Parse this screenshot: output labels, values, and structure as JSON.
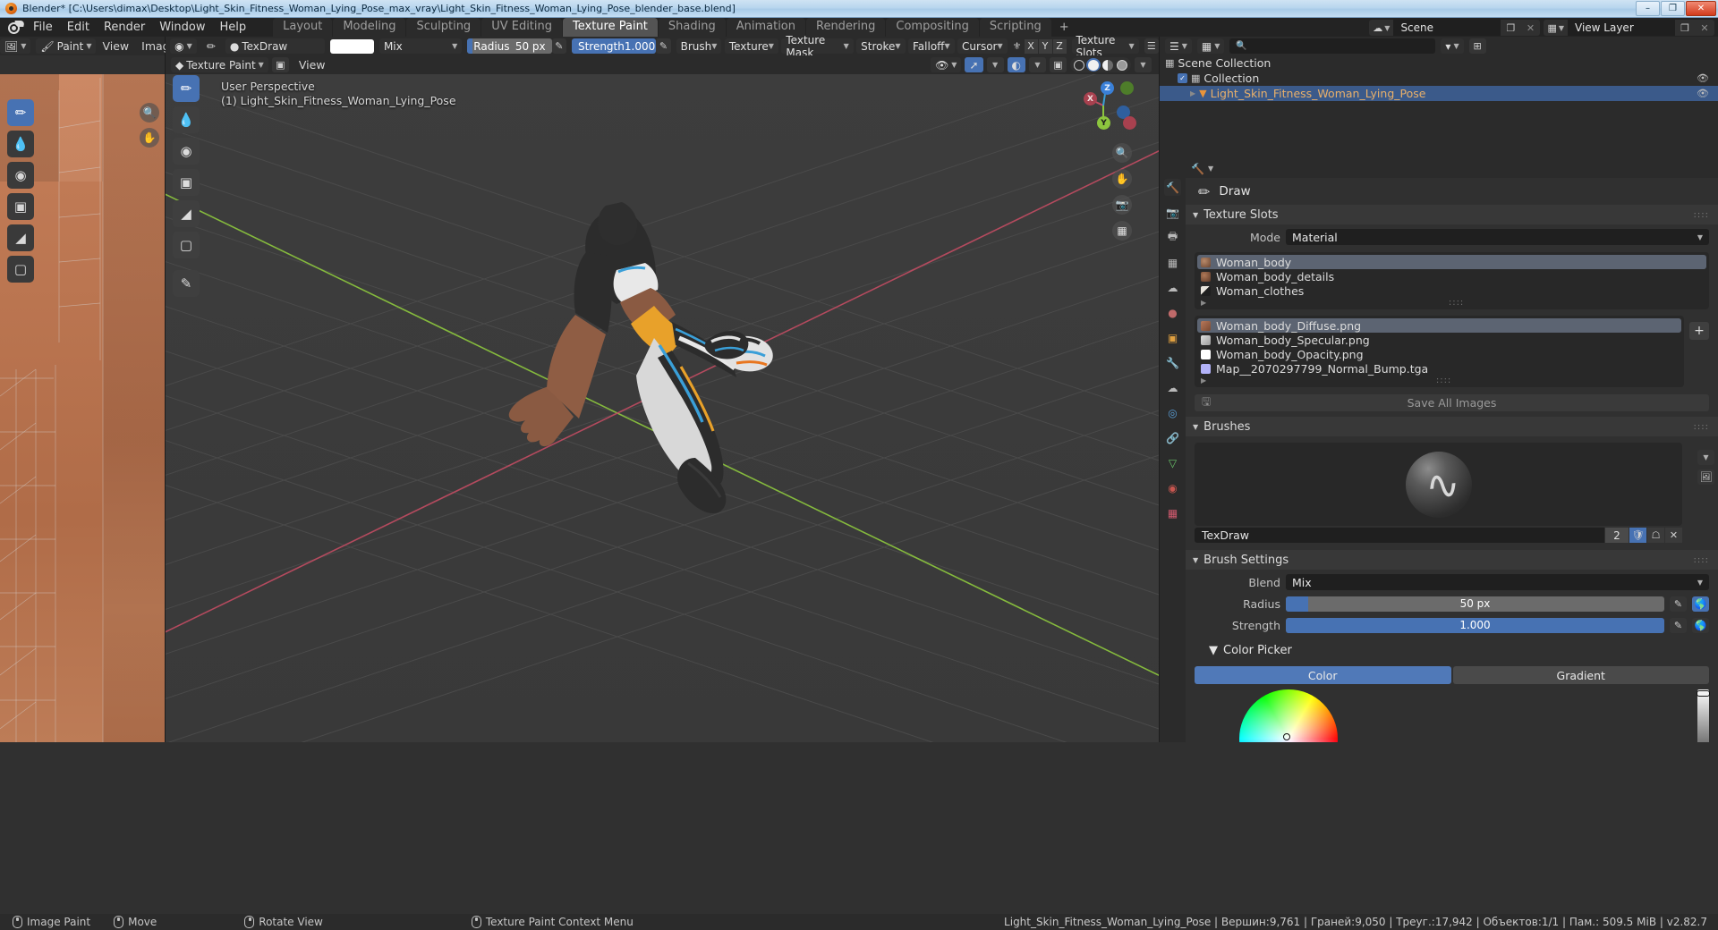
{
  "window": {
    "title": "Blender* [C:\\Users\\dimax\\Desktop\\Light_Skin_Fitness_Woman_Lying_Pose_max_vray\\Light_Skin_Fitness_Woman_Lying_Pose_blender_base.blend]",
    "minimize": "–",
    "maximize": "❐",
    "close": "✕"
  },
  "menu": {
    "items": [
      "File",
      "Edit",
      "Render",
      "Window",
      "Help"
    ]
  },
  "workspaces": {
    "tabs": [
      "Layout",
      "Modeling",
      "Sculpting",
      "UV Editing",
      "Texture Paint",
      "Shading",
      "Animation",
      "Rendering",
      "Compositing",
      "Scripting"
    ],
    "active": "Texture Paint",
    "add": "+"
  },
  "topbar_right": {
    "scene_label": "Scene",
    "scene_icon": "scene-icon",
    "viewlayer_label": "View Layer",
    "viewlayer_icon": "viewlayer-icon",
    "copy_icon": "❐",
    "close_icon": "✕"
  },
  "image_editor": {
    "editor_icon": "image-editor-icon",
    "mode": "Paint",
    "menus": [
      "View",
      "Image"
    ],
    "tools": [
      "brush-tool",
      "smear-tool",
      "soften-tool",
      "clone-tool",
      "fill-tool",
      "mask-tool"
    ],
    "active_tool": "brush-tool",
    "nav_icons": [
      "zoom-icon",
      "hand-icon"
    ]
  },
  "tool_header": {
    "editor_icon": "texture-paint-editor-icon",
    "brush_icon": "brush-icon",
    "texture_icon": "texture-icon",
    "brush_name": "TexDraw",
    "color_swatch": "#ffffff",
    "blend": "Mix",
    "radius_label": "Radius",
    "radius_value": "50 px",
    "radius_fill_pct": 6,
    "strength_label": "Strength",
    "strength_value": "1.000",
    "strength_fill_pct": 100,
    "popovers": [
      "Brush",
      "Texture",
      "Texture Mask",
      "Stroke",
      "Falloff",
      "Cursor"
    ],
    "symmetry_label": "symmetry-icon",
    "axes": [
      "X",
      "Y",
      "Z"
    ],
    "texture_slots_popover": "Texture Slots"
  },
  "viewport": {
    "mode": "Texture Paint",
    "menus": [
      "View"
    ],
    "perspective": "User Perspective",
    "object_line": "(1) Light_Skin_Fitness_Woman_Lying_Pose",
    "tools": [
      "draw-tool",
      "soften-tool",
      "smear-tool",
      "clone-tool",
      "fill-tool",
      "mask-tool",
      "annotate-tool"
    ],
    "active_tool": "draw-tool",
    "gizmo_axes": [
      "X",
      "Y",
      "Z"
    ],
    "nav_icons": [
      "zoom-icon",
      "hand-icon",
      "camera-icon",
      "ortho-icon"
    ],
    "overlay_icons": [
      "visibility-icon",
      "gizmo-icon",
      "overlays-icon",
      "xray-icon"
    ],
    "shading_modes": [
      "wireframe",
      "solid",
      "material",
      "rendered"
    ],
    "active_shading": "solid"
  },
  "outliner": {
    "header_icons": [
      "editor-icon",
      "display-mode-icon",
      "filter-icon",
      "new-collection-icon"
    ],
    "search_placeholder": "",
    "rows": [
      {
        "name": "Scene Collection",
        "icon": "scene-collection-icon",
        "indent": 0,
        "selected": false,
        "checkbox": false,
        "eye": false
      },
      {
        "name": "Collection",
        "icon": "collection-icon",
        "indent": 1,
        "selected": false,
        "checkbox": true,
        "eye": true
      },
      {
        "name": "Light_Skin_Fitness_Woman_Lying_Pose",
        "icon": "mesh-icon",
        "indent": 2,
        "selected": true,
        "checkbox": false,
        "eye": true
      }
    ]
  },
  "properties": {
    "tabs": [
      "tool-tab",
      "render-tab",
      "output-tab",
      "view-layer-tab",
      "scene-tab",
      "world-tab",
      "object-tab",
      "modifiers-tab",
      "particles-tab",
      "physics-tab",
      "constraints-tab",
      "data-tab",
      "material-tab",
      "texture-tab"
    ],
    "active_tab": "tool-tab",
    "breadcrumb_icon": "tool-icon",
    "tool_name": "Draw",
    "texture_slots": {
      "title": "Texture Slots",
      "mode_label": "Mode",
      "mode_value": "Material",
      "materials": [
        {
          "name": "Woman_body",
          "selected": true,
          "color": "#8a5a42"
        },
        {
          "name": "Woman_body_details",
          "selected": false,
          "color": "#8a5a42"
        },
        {
          "name": "Woman_clothes",
          "selected": false,
          "color": "#c8c0b4"
        }
      ],
      "images": [
        {
          "name": "Woman_body_Diffuse.png",
          "selected": true,
          "color": "#a5674a"
        },
        {
          "name": "Woman_body_Specular.png",
          "selected": false,
          "color": "#d8d8d8"
        },
        {
          "name": "Woman_body_Opacity.png",
          "selected": false,
          "color": "#ffffff"
        },
        {
          "name": "Map__2070297799_Normal_Bump.tga",
          "selected": false,
          "color": "#b0b0f8"
        }
      ],
      "add_button": "+",
      "save_all_label": "Save All Images"
    },
    "brushes": {
      "title": "Brushes",
      "brush_name": "TexDraw",
      "users_count": "2",
      "fake_user_icon": "shield-icon",
      "duplicate_icon": "copy-icon",
      "unlink_icon": "✕",
      "dropdown_icon": "chevron-down-icon",
      "preview_icon": "image-icon"
    },
    "brush_settings": {
      "title": "Brush Settings",
      "blend_label": "Blend",
      "blend_value": "Mix",
      "radius_label": "Radius",
      "radius_value": "50 px",
      "radius_fill_pct": 6,
      "strength_label": "Strength",
      "strength_value": "1.000",
      "strength_fill_pct": 100,
      "pressure_icon": "pressure-icon",
      "unified_icon": "globe-icon"
    },
    "color_picker": {
      "title": "Color Picker",
      "tab_color": "Color",
      "tab_gradient": "Gradient",
      "active_tab": "Color"
    }
  },
  "statusbar": {
    "items": [
      {
        "icon": "mouse-left-icon",
        "label": "Image Paint"
      },
      {
        "icon": "mouse-middle-icon",
        "label": "Move"
      },
      {
        "icon": "mouse-middle-icon",
        "label": "Rotate View"
      },
      {
        "icon": "mouse-right-icon",
        "label": "Texture Paint Context Menu"
      }
    ],
    "stats": "Light_Skin_Fitness_Woman_Lying_Pose | Вершин:9,761 | Граней:9,050 | Треуг.:17,942 | Объектов:1/1 | Пам.: 509.5 MiB | v2.82.7"
  },
  "colors": {
    "accent_blue": "#4772b3",
    "selection_blue": "#3b5a8a",
    "panel_bg": "#303030",
    "header_bg": "#2b2b2b",
    "viewport_bg": "#3b3b3b",
    "x_axis": "#bf4c62",
    "y_axis": "#8cc63e",
    "outliner_text_orange": "#e9b06a"
  }
}
